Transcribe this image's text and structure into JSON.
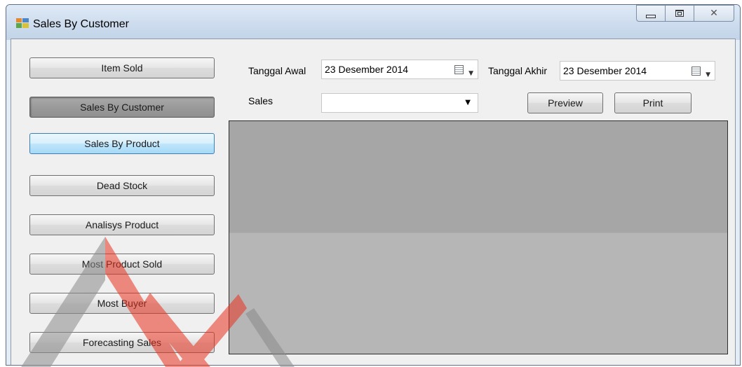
{
  "window": {
    "title": "Sales By Customer",
    "icon": "form-icon",
    "controls": [
      "minimize-icon",
      "maximize-icon",
      "close-icon"
    ]
  },
  "sidebar": {
    "items": [
      {
        "label": "Item Sold",
        "state": "normal"
      },
      {
        "label": "Sales By Customer",
        "state": "pressed"
      },
      {
        "label": "Sales By Product",
        "state": "focused"
      },
      {
        "label": "Dead Stock",
        "state": "normal"
      },
      {
        "label": "Analisys Product",
        "state": "normal"
      },
      {
        "label": "Most Product Sold",
        "state": "normal"
      },
      {
        "label": "Most Buyer",
        "state": "normal"
      },
      {
        "label": "Forecasting Sales",
        "state": "normal"
      }
    ]
  },
  "filters": {
    "start_date_label": "Tanggal Awal",
    "start_date_value": "23 Desember 2014",
    "end_date_label": "Tanggal Akhir",
    "end_date_value": "23 Desember 2014",
    "sales_label": "Sales",
    "sales_value": ""
  },
  "actions": {
    "preview_label": "Preview",
    "print_label": "Print"
  },
  "colors": {
    "viewer_top": "#a6a6a6",
    "viewer_bottom": "#b6b6b6",
    "watermark_red": "#e8321e",
    "watermark_gray": "#8a8a8a"
  }
}
